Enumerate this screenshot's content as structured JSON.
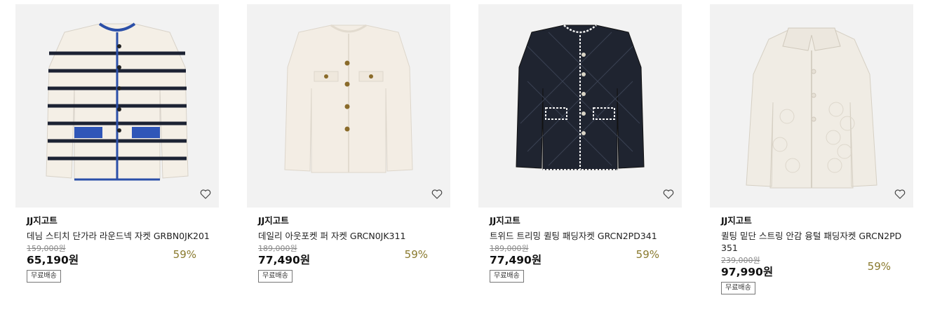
{
  "products": [
    {
      "brand": "JJ지고트",
      "title": "데님 스티치 단가라 라운드넥 자켓 GRBN0JK201",
      "original_price": "159,000원",
      "price": "65,190원",
      "discount": "59%",
      "badge": "무료배송"
    },
    {
      "brand": "JJ지고트",
      "title": "데일리 아웃포켓 퍼 자켓 GRCN0JK311",
      "original_price": "189,000원",
      "price": "77,490원",
      "discount": "59%",
      "badge": "무료배송"
    },
    {
      "brand": "JJ지고트",
      "title": "트위드 트리밍 퀼팅 패딩자켓 GRCN2PD341",
      "original_price": "189,000원",
      "price": "77,490원",
      "discount": "59%",
      "badge": "무료배송"
    },
    {
      "brand": "JJ지고트",
      "title": "퀼팅 밑단 스트링 안감 융털 패딩자켓 GRCN2PD351",
      "original_price": "239,000원",
      "price": "97,990원",
      "discount": "59%",
      "badge": "무료배송"
    }
  ],
  "icons": {
    "wishlist": "heart-outline-icon"
  },
  "colors": {
    "discount": "#8a7a2e",
    "thumb_bg": "#f2f2f2"
  }
}
